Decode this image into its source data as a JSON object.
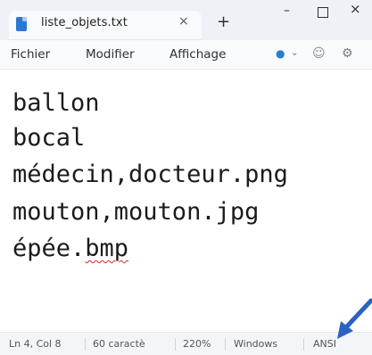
{
  "titlebar": {
    "tab_title": "liste_objets.txt",
    "tab_close": "×",
    "new_tab": "+",
    "minimize": "–",
    "close": "×"
  },
  "menubar": {
    "items": [
      "Fichier",
      "Modifier",
      "Affichage"
    ]
  },
  "editor": {
    "lines": [
      "ballon",
      "bocal",
      "médecin,docteur.png",
      "mouton,mouton.jpg",
      "épée."
    ],
    "line5_misspelled": "bmp"
  },
  "statusbar": {
    "position": "Ln 4, Col 8",
    "chars": "60 caractè",
    "zoom": "220%",
    "line_ending": "Windows",
    "encoding": "ANSI"
  },
  "colors": {
    "accent": "#2c77d4",
    "arrow": "#2b63c4",
    "spellcheck": "#d12b2b"
  }
}
